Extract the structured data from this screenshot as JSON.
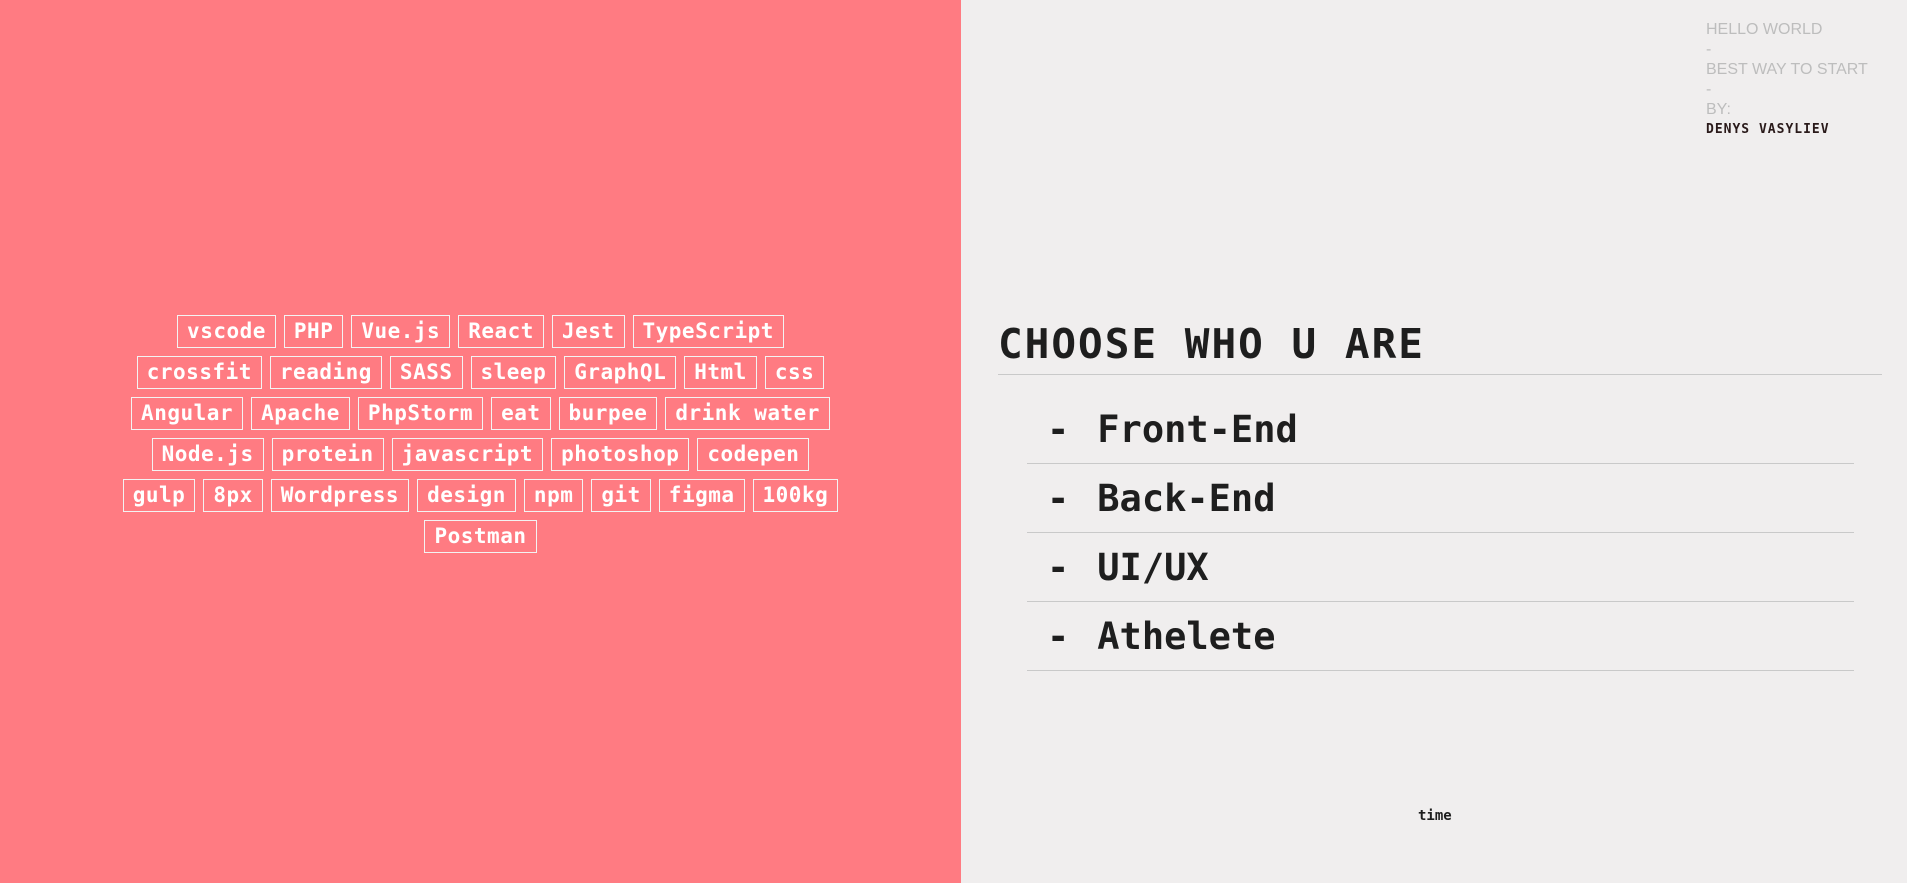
{
  "tags": [
    [
      "vscode",
      "PHP",
      "Vue.js",
      "React",
      "Jest",
      "TypeScript"
    ],
    [
      "crossfit",
      "reading",
      "SASS",
      "sleep",
      "GraphQL",
      "Html",
      "css"
    ],
    [
      "Angular",
      "Apache",
      "PhpStorm",
      "eat",
      "burpee",
      "drink water"
    ],
    [
      "Node.js",
      "protein",
      "javascript",
      "photoshop",
      "codepen"
    ],
    [
      "gulp",
      "8px",
      "Wordpress",
      "design",
      "npm",
      "git",
      "figma",
      "100kg"
    ],
    [
      "Postman"
    ]
  ],
  "credit": {
    "line1": "HELLO WORLD",
    "sep1": "-",
    "line2": "BEST WAY TO START",
    "sep2": "-",
    "line3": "BY:",
    "author": "DENYS VASYLIEV"
  },
  "heading": "CHOOSE WHO U ARE",
  "roles": {
    "dash": "-",
    "items": [
      "Front-End",
      "Back-End",
      "UI/UX",
      "Athelete"
    ]
  },
  "time": "time",
  "colors": {
    "left_bg": "#ff7b82",
    "right_bg": "#f0eeee"
  }
}
